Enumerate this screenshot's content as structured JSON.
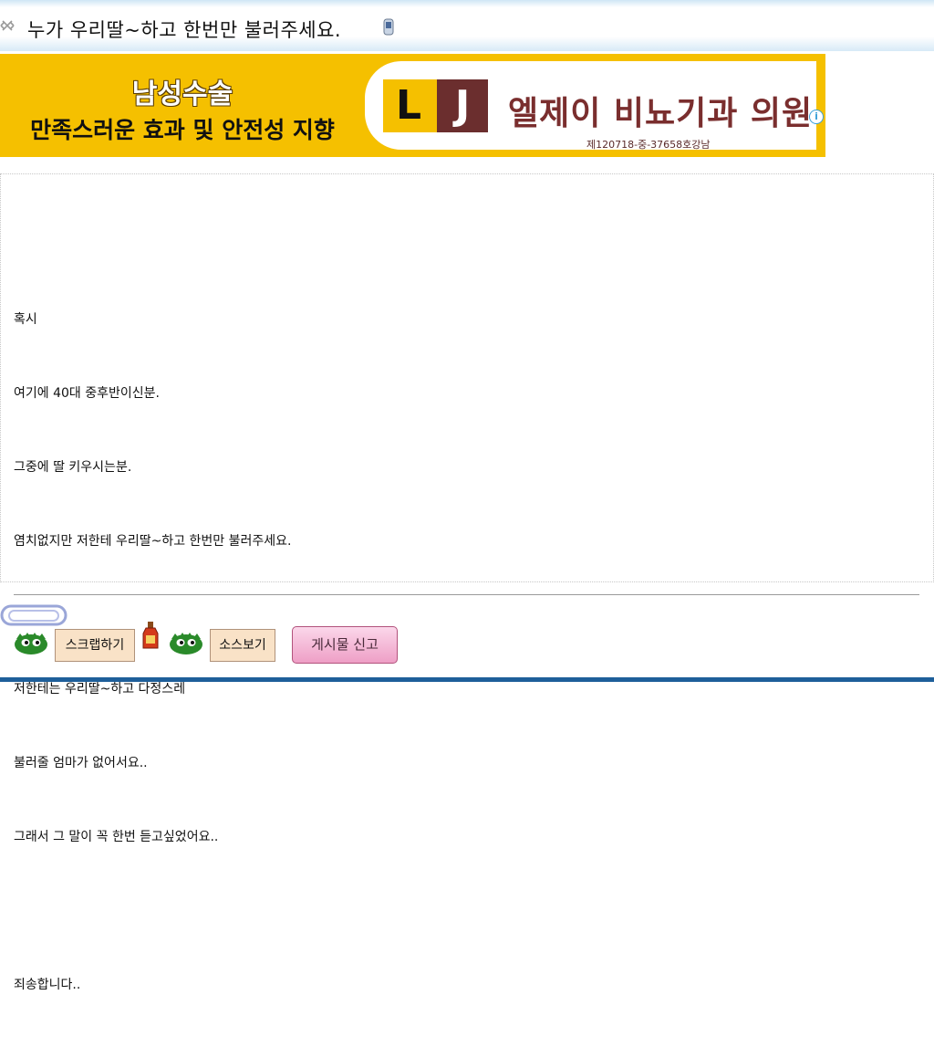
{
  "title": "누가 우리딸~하고 한번만 불러주세요.",
  "ad": {
    "headline": "남성수술",
    "subline": "만족스러운 효과 및 안전성 지향",
    "logo_left": "L",
    "logo_right": "J",
    "clinic_name": "엘제이 비뇨기과 의원",
    "registration": "제120718-중-37658호강남",
    "info_glyph": "i",
    "colors": {
      "yellow": "#f5c000",
      "maroon": "#6b2e2e"
    }
  },
  "post": {
    "lines": [
      "혹시",
      "여기에 40대 중후반이신분.",
      "그중에 딸 키우시는분.",
      "염치없지만 저한테 우리딸~하고 한번만 불러주세요.",
      "",
      "저한테는 우리딸~하고 다정스레",
      "불러줄 엄마가 없어서요..",
      "그래서 그 말이 꼭 한번 듣고싶었어요..",
      "",
      "죄송합니다.."
    ]
  },
  "footer": {
    "scrap_label": "스크랩하기",
    "source_label": "소스보기",
    "report_label": "게시물 신고"
  },
  "icons": {
    "title": "cross-hatch-icon",
    "phone": "phone-icon",
    "clip": "paperclip-icon",
    "monster": "green-monster-icon",
    "bottle": "bottle-icon"
  }
}
